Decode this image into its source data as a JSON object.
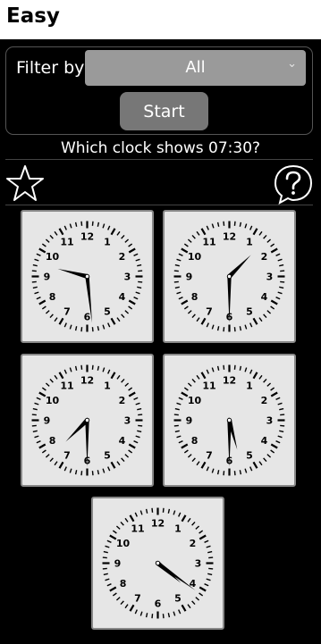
{
  "header": {
    "title": "Easy"
  },
  "filter": {
    "label": "Filter by",
    "selected": "All",
    "start_label": "Start"
  },
  "question": {
    "text": "Which clock shows 07:30?"
  },
  "clocks": [
    {
      "id": "clock-1",
      "time": "09:29"
    },
    {
      "id": "clock-2",
      "time": "01:30"
    },
    {
      "id": "clock-3",
      "time": "07:30"
    },
    {
      "id": "clock-4",
      "time": "05:30"
    },
    {
      "id": "clock-5",
      "time": "04:21"
    }
  ],
  "dial_numbers": [
    "12",
    "1",
    "2",
    "3",
    "4",
    "5",
    "6",
    "7",
    "8",
    "9",
    "10",
    "11"
  ],
  "icons": {
    "favorite": "star-icon",
    "help": "help-icon",
    "dropdown": "chevron-down-icon"
  }
}
